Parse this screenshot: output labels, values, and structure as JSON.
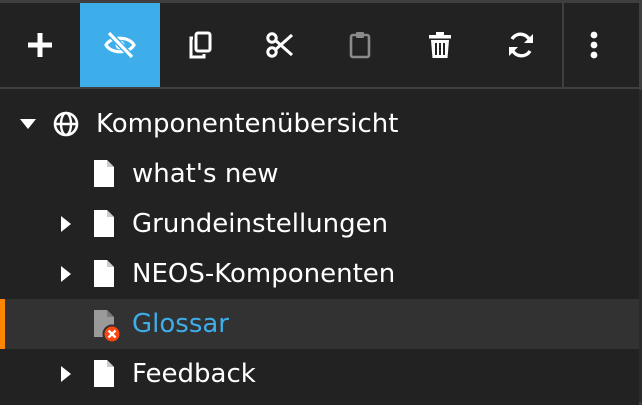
{
  "toolbar": {
    "buttons": [
      {
        "name": "add-node-button",
        "icon": "plus-icon",
        "title": "Add"
      },
      {
        "name": "toggle-hidden-button",
        "icon": "eye-slash-icon",
        "title": "Hide / Unhide",
        "active": true
      },
      {
        "name": "copy-button",
        "icon": "copy-icon",
        "title": "Copy"
      },
      {
        "name": "cut-button",
        "icon": "scissors-icon",
        "title": "Cut"
      },
      {
        "name": "paste-button",
        "icon": "clipboard-icon",
        "title": "Paste",
        "disabled": true
      },
      {
        "name": "delete-button",
        "icon": "trash-icon",
        "title": "Delete"
      },
      {
        "name": "refresh-button",
        "icon": "sync-icon",
        "title": "Refresh"
      },
      {
        "name": "more-button",
        "icon": "ellipsis-vertical-icon",
        "title": "More"
      }
    ],
    "active_color": "#3daee9"
  },
  "tree": {
    "root": {
      "label": "Komponentenübersicht",
      "icon": "globe-icon",
      "expanded": true
    },
    "children": [
      {
        "label": "what's new",
        "icon": "file-icon",
        "has_children": false
      },
      {
        "label": "Grundeinstellungen",
        "icon": "file-icon",
        "has_children": true
      },
      {
        "label": "NEOS-Komponenten",
        "icon": "file-icon",
        "has_children": true
      },
      {
        "label": "Glossar",
        "icon": "file-error-icon",
        "has_children": false,
        "selected": true,
        "status": "error"
      },
      {
        "label": "Feedback",
        "icon": "file-icon",
        "has_children": true
      }
    ],
    "colors": {
      "selected_marker": "#ff8700",
      "error_text": "#3daee9",
      "error_badge": "#ff460d"
    }
  }
}
